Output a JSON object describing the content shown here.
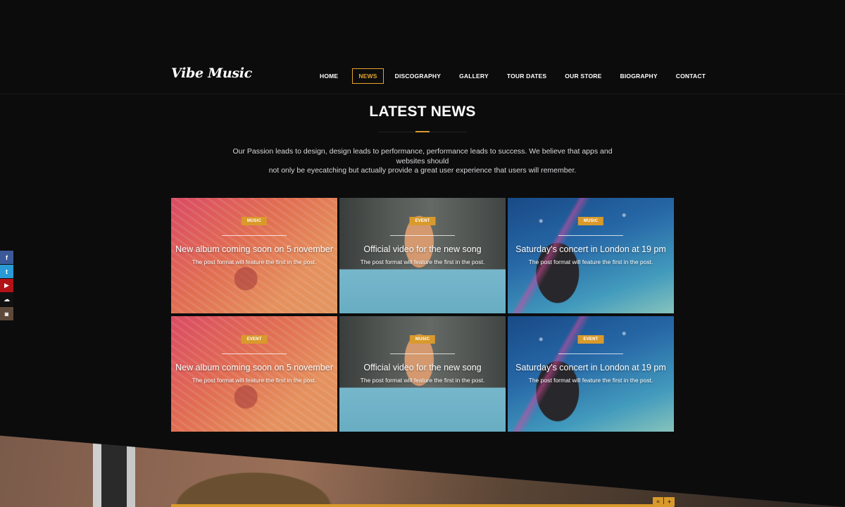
{
  "header": {
    "logo": "Vibe Music",
    "nav": [
      "HOME",
      "NEWS",
      "DISCOGRAPHY",
      "GALLERY",
      "TOUR DATES",
      "OUR STORE",
      "BIOGRAPHY",
      "CONTACT"
    ],
    "active_nav": "NEWS"
  },
  "section": {
    "title": "LATEST NEWS",
    "intro_line1": "Our Passion leads to design, design leads to performance, performance leads to success. We believe that apps and websites should",
    "intro_line2": "not only be eyecatching but actually provide a great user experience that users will remember."
  },
  "social": [
    {
      "name": "facebook",
      "glyph": "f"
    },
    {
      "name": "twitter",
      "glyph": "t"
    },
    {
      "name": "youtube",
      "glyph": "▶"
    },
    {
      "name": "soundcloud",
      "glyph": "☁"
    },
    {
      "name": "instagram",
      "glyph": "◙"
    }
  ],
  "news": [
    {
      "badge": "MUSIC",
      "title": "New album coming soon on 5 november",
      "excerpt": "The post format will feature the first in the post."
    },
    {
      "badge": "EVENT",
      "title": "Official video for the new song",
      "excerpt": "The post format will feature the first in the post."
    },
    {
      "badge": "MUSIC",
      "title": "Saturday's concert in London at 19 pm",
      "excerpt": "The post format will feature the first in the post."
    },
    {
      "badge": "EVENT",
      "title": "New album coming soon on 5 november",
      "excerpt": "The post format will feature the first in the post."
    },
    {
      "badge": "MUSIC",
      "title": "Official video for the new song",
      "excerpt": "The post format will feature the first in the post."
    },
    {
      "badge": "EVENT",
      "title": "Saturday's concert in London at 19 pm",
      "excerpt": "The post format will feature the first in the post."
    }
  ],
  "corner_controls": [
    "≡",
    "+"
  ],
  "colors": {
    "accent": "#d99a2b",
    "background": "#0c0c0d"
  }
}
